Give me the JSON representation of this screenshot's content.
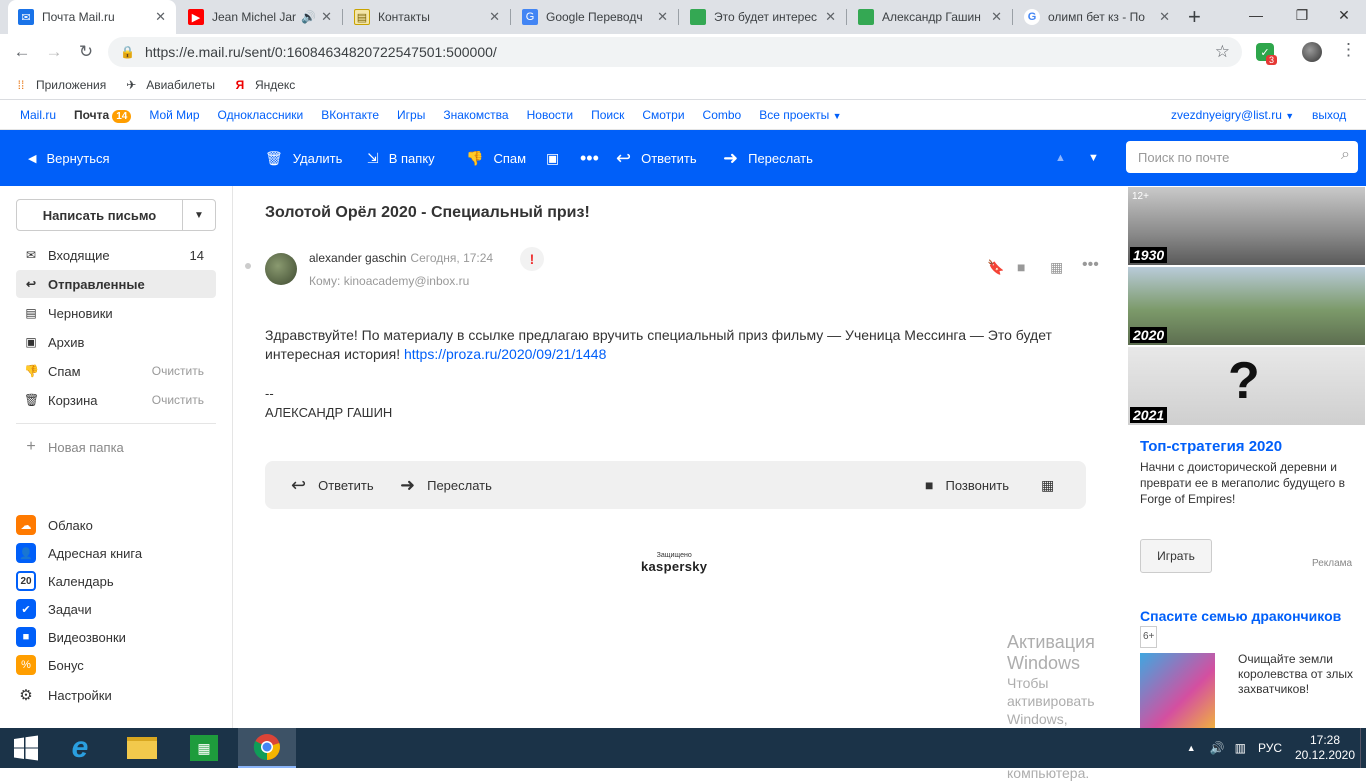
{
  "browser": {
    "tabs": [
      {
        "label": "Почта Mail.ru",
        "icon": "mail-icon",
        "color": "#1a73e8"
      },
      {
        "label": "Jean Michel Jar",
        "icon": "youtube-icon",
        "color": "#ff0000"
      },
      {
        "label": "Контакты",
        "icon": "contacts-icon",
        "color": "#e0c060"
      },
      {
        "label": "Google Переводч",
        "icon": "translate-icon",
        "color": "#4285f4"
      },
      {
        "label": "Это будет интерес",
        "icon": "page-icon",
        "color": "#34a853"
      },
      {
        "label": "Александр Гашин",
        "icon": "page-icon",
        "color": "#34a853"
      },
      {
        "label": "олимп бет кз - По",
        "icon": "google-icon",
        "color": "#4285f4"
      }
    ],
    "url": "https://e.mail.ru/sent/0:16084634820722547501:500000/",
    "ext_badge": "3",
    "bookmarks": [
      {
        "label": "Приложения",
        "icon": "apps-icon"
      },
      {
        "label": "Авиабилеты",
        "icon": "plane-icon"
      },
      {
        "label": "Яндекс",
        "icon": "yandex-icon"
      }
    ]
  },
  "portal": {
    "links": [
      "Mail.ru",
      "Почта",
      "Мой Мир",
      "Одноклассники",
      "ВКонтакте",
      "Игры",
      "Знакомства",
      "Новости",
      "Поиск",
      "Смотри",
      "Combo",
      "Все проекты"
    ],
    "mail_count": "14",
    "user": "zvezdnyeigry@list.ru",
    "logout": "выход"
  },
  "toolbar": {
    "back": "Вернуться",
    "delete": "Удалить",
    "move": "В папку",
    "spam": "Спам",
    "reply": "Ответить",
    "forward": "Переслать",
    "search_placeholder": "Поиск по почте"
  },
  "sidebar": {
    "compose": "Написать письмо",
    "folders": [
      {
        "label": "Входящие",
        "count": "14",
        "icon": "inbox-icon"
      },
      {
        "label": "Отправленные",
        "icon": "sent-icon"
      },
      {
        "label": "Черновики",
        "icon": "drafts-icon"
      },
      {
        "label": "Архив",
        "icon": "archive-icon"
      },
      {
        "label": "Спам",
        "action": "Очистить",
        "icon": "spam-icon"
      },
      {
        "label": "Корзина",
        "action": "Очистить",
        "icon": "trash-icon"
      }
    ],
    "new_folder": "Новая папка",
    "services": [
      {
        "label": "Облако",
        "icon": "cloud-icon",
        "color": "#ff7a00"
      },
      {
        "label": "Адресная книга",
        "icon": "contacts-icon",
        "color": "#005ff9"
      },
      {
        "label": "Календарь",
        "icon": "calendar-icon",
        "color": "#005ff9",
        "day": "20"
      },
      {
        "label": "Задачи",
        "icon": "tasks-icon",
        "color": "#005ff9"
      },
      {
        "label": "Видеозвонки",
        "icon": "video-icon",
        "color": "#005ff9"
      },
      {
        "label": "Бонус",
        "icon": "bonus-icon",
        "color": "#ff9e00"
      },
      {
        "label": "Настройки",
        "icon": "gear-icon",
        "color": "#333"
      }
    ]
  },
  "message": {
    "subject": "Золотой Орёл 2020 - Специальный приз!",
    "sender": "alexander gaschin",
    "time": "Сегодня, 17:24",
    "to": "Кому: kinoacademy@inbox.ru",
    "body": "Здравствуйте! По материалу в ссылке предлагаю вручить специальный приз фильму — Ученица Мессинга —  Это будет интересная история!",
    "link": "https://proza.ru/2020/09/21/1448",
    "sig_dash": "--",
    "signature": "АЛЕКСАНДР ГАШИН",
    "reply": "Ответить",
    "forward": "Переслать",
    "call": "Позвонить",
    "protected": "Защищено",
    "kaspersky": "kaspersky"
  },
  "watermark": {
    "title": "Активация Windows",
    "line1": "Чтобы активировать Windows, перейдите в",
    "line2": "параметрам компьютера."
  },
  "ad": {
    "years": [
      "1930",
      "2020",
      "2021"
    ],
    "age_tag": "12+",
    "title": "Топ-стратегия 2020",
    "text": "Начни с доисторической деревни и преврати ее в мегаполис будущего в Forge of Empires!",
    "button": "Играть",
    "label": "Реклама",
    "title2": "Спасите семью дракончиков",
    "age2": "6+",
    "text2": "Очищайте земли королевства от злых захватчиков!"
  },
  "taskbar": {
    "lang": "РУС",
    "time": "17:28",
    "date": "20.12.2020"
  }
}
